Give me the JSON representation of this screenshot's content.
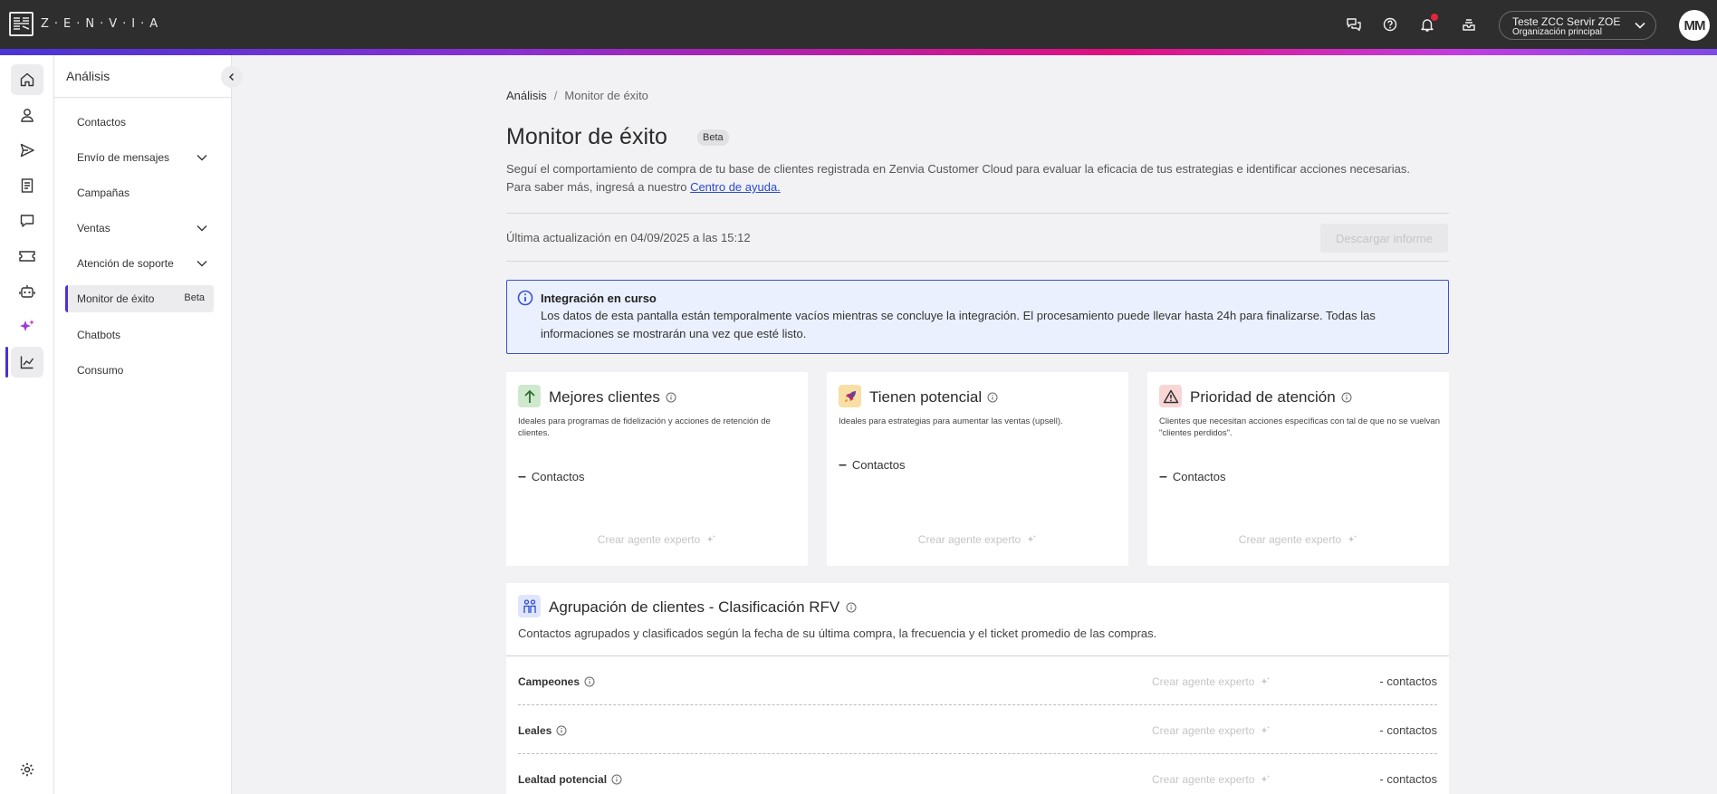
{
  "brand": {
    "logo_text": "Z·E·N·V·I·A"
  },
  "topbar": {
    "org_name": "Teste ZCC Servir ZOE",
    "org_sub": "Organización principal",
    "avatar_initials": "MM",
    "icons": [
      "chat-icon",
      "help-icon",
      "bell-icon",
      "inbox-icon"
    ]
  },
  "subnav": {
    "title": "Análisis",
    "items": [
      {
        "label": "Contactos"
      },
      {
        "label": "Envío de mensajes"
      },
      {
        "label": "Campañas"
      },
      {
        "label": "Ventas"
      },
      {
        "label": "Atención de soporte"
      },
      {
        "label": "Monitor de éxito",
        "badge": "Beta"
      },
      {
        "label": "Chatbots"
      },
      {
        "label": "Consumo"
      }
    ]
  },
  "breadcrumb": {
    "root": "Análisis",
    "separator": "/",
    "current": "Monitor de éxito"
  },
  "page": {
    "title": "Monitor de éxito",
    "badge": "Beta",
    "desc_line1": "Seguí el comportamiento de compra de tu base de clientes registrada en Zenvia Customer Cloud para evaluar la eficacia de tus estrategias e identificar acciones necesarias.",
    "desc_line2": "Para saber más, ingresá a nuestro ",
    "help_link": "Centro de ayuda.",
    "updated": "Última actualización en 04/09/2025 a las 15:12",
    "download_label": "Descargar informe"
  },
  "alert": {
    "title": "Integración en curso",
    "text": "Los datos de esta pantalla están temporalmente vacíos mientras se concluye la integración. El procesamiento puede llevar hasta 24h para finalizarse. Todas las informaciones se mostrarán una vez que esté listo."
  },
  "cards": [
    {
      "title": "Mejores clientes",
      "desc": "Ideales para programas de fidelización y acciones de retención de clientes.",
      "value": "Contactos",
      "cta": "Crear agente experto",
      "icon": "arrow-up-icon",
      "icon_bg": "#cfe9cf"
    },
    {
      "title": "Tienen potencial",
      "desc": "Ideales para estrategias para aumentar las ventas (upsell).",
      "value": "Contactos",
      "cta": "Crear agente experto",
      "icon": "rocket-icon",
      "icon_bg": "#f8dfa6"
    },
    {
      "title": "Prioridad de atención",
      "desc": "Clientes que necesitan acciones específicas con tal de que no se vuelvan \"clientes perdidos\".",
      "value": "Contactos",
      "cta": "Crear agente experto",
      "icon": "warning-icon",
      "icon_bg": "#f8d6d6"
    }
  ],
  "rfv": {
    "title": "Agrupación de clientes - Clasificación RFV",
    "desc": "Contactos agrupados y clasificados según la fecha de su última compra, la frecuencia y el ticket promedio de las compras.",
    "rows": [
      {
        "name": "Campeones",
        "cta": "Crear agente experto",
        "count": "- contactos"
      },
      {
        "name": "Leales",
        "cta": "Crear agente experto",
        "count": "- contactos"
      },
      {
        "name": "Lealtad potencial",
        "cta": "Crear agente experto",
        "count": "- contactos"
      }
    ]
  },
  "colors": {
    "accent": "#4b2fd8",
    "link": "#2a4ad2",
    "alert_border": "#3a52cf",
    "alert_bg": "#eaf0fd"
  }
}
